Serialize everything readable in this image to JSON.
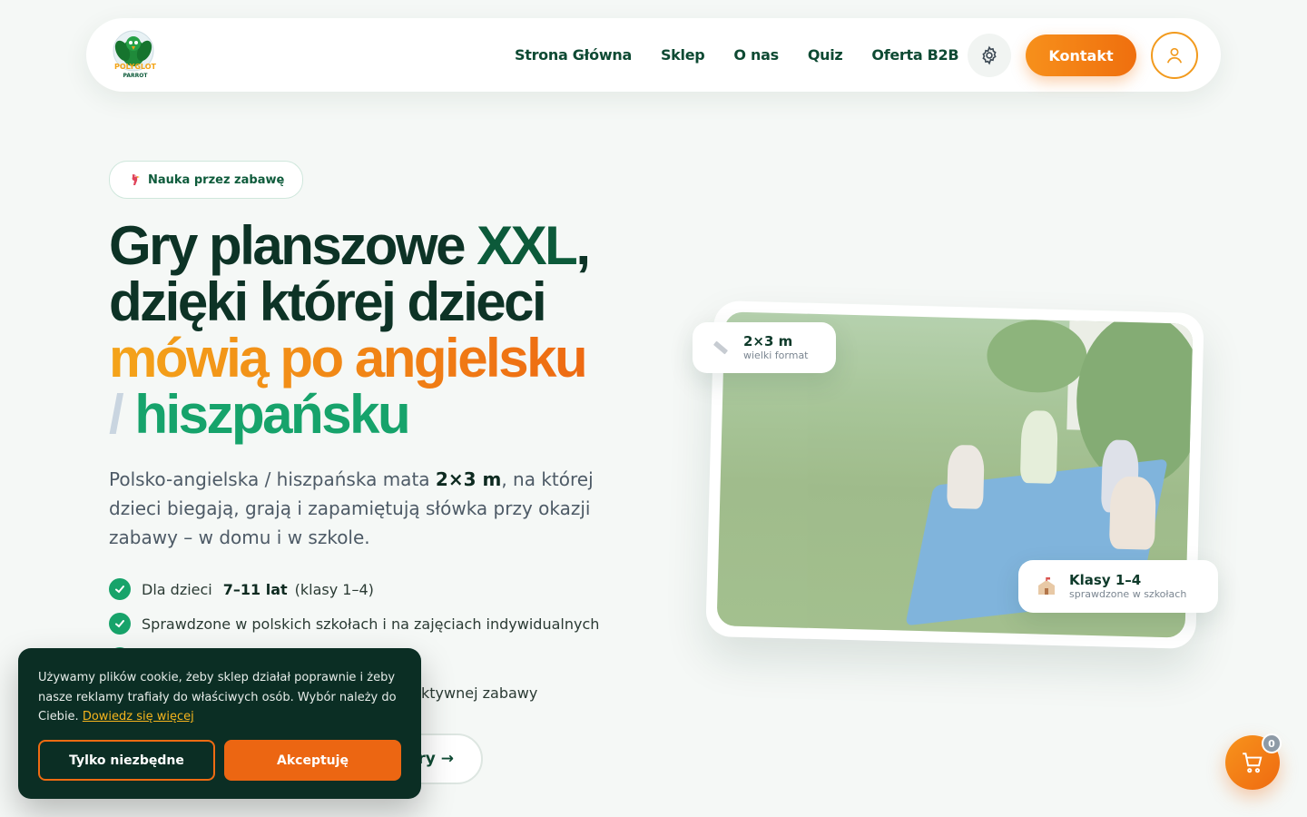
{
  "nav": {
    "logo_line1": "POLYGLOT",
    "logo_line2": "PARROT",
    "links": [
      "Strona Główna",
      "Sklep",
      "O nas",
      "Quiz",
      "Oferta B2B"
    ],
    "contact_label": "Kontakt"
  },
  "hero": {
    "badge": "Nauka przez zabawę",
    "headline": {
      "part1": "Gry planszowe ",
      "part1_accent": "XXL",
      "part1_end": ",",
      "line2": "dzięki której dzieci",
      "line3": "mówią po angielsku",
      "slash": "/ ",
      "line4": "hiszpańsku"
    },
    "lead_before": "Polsko-angielska / hiszpańska mata ",
    "lead_bold": "2×3 m",
    "lead_after": ", na której dzieci biegają, grają i zapamiętują słówka przy okazji zabawy – w domu i w szkole.",
    "features": [
      {
        "pre": "Dla dzieci",
        "bold": "7–11 lat",
        "post": "(klasy 1–4)"
      },
      {
        "pre": "Sprawdzone w polskich szkołach i na zajęciach indywidualnych",
        "bold": "",
        "post": ""
      },
      {
        "pre": "",
        "bold": "",
        "post": ""
      },
      {
        "pre": "",
        "bold": "",
        "post": "ktywnej zabawy"
      }
    ],
    "cta_label": "ry →"
  },
  "image_tags": {
    "size_title": "2×3 m",
    "size_sub": "wielki format",
    "grade_title": "Klasy 1–4",
    "grade_sub": "sprawdzone w szkołach"
  },
  "cookie": {
    "text": "Używamy plików cookie, żeby sklep działał poprawnie i żeby nasze reklamy trafiały do właściwych osób. Wybór należy do Ciebie.",
    "link": "Dowiedz się więcej",
    "essential_label": "Tylko niezbędne",
    "accept_label": "Akceptuję"
  },
  "cart": {
    "count": "0"
  },
  "colors": {
    "accent_orange": "#ef6b12",
    "brand_green": "#0c5a3a",
    "teal": "#16a36b",
    "cookie_bg": "#0b2e24"
  }
}
